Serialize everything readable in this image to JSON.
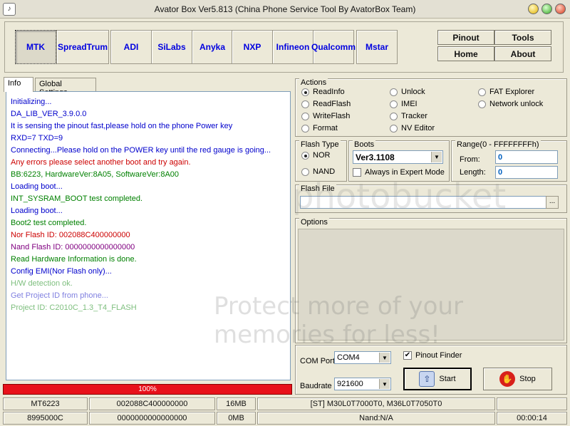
{
  "window": {
    "title": "Avator Box Ver5.813 (China Phone Service Tool By AvatorBox Team)"
  },
  "chips": [
    "MTK",
    "SpreadTrum",
    "ADI",
    "SiLabs",
    "Anyka",
    "NXP",
    "Infineon",
    "Qualcomm",
    "Mstar"
  ],
  "nav": {
    "pinout": "Pinout",
    "tools": "Tools",
    "home": "Home",
    "about": "About"
  },
  "tabs": {
    "info": "Info",
    "global": "Global Settings"
  },
  "log": [
    {
      "text": "Initializing...",
      "color": "#0000cc"
    },
    {
      "text": "DA_LIB_VER_3.9.0.0",
      "color": "#0000cc"
    },
    {
      "text": "It is sensing the pinout fast,please hold on the phone Power key",
      "color": "#0000cc"
    },
    {
      "text": "RXD=7  TXD=9",
      "color": "#0000cc"
    },
    {
      "text": "Connecting...Please hold on the POWER key until the red gauge is going...",
      "color": "#0000cc"
    },
    {
      "text": "Any errors please select another boot and try again.",
      "color": "#cc0000"
    },
    {
      "text": "BB:6223,     HardwareVer:8A05,     SoftwareVer:8A00",
      "color": "#008000"
    },
    {
      "text": "Loading boot...",
      "color": "#0000cc"
    },
    {
      "text": "INT_SYSRAM_BOOT test completed.",
      "color": "#008000"
    },
    {
      "text": "Loading boot...",
      "color": "#0000cc"
    },
    {
      "text": "Boot2 test completed.",
      "color": "#008000"
    },
    {
      "text": "Nor Flash ID: 002088C400000000",
      "color": "#cc0000"
    },
    {
      "text": "Nand Flash ID: 0000000000000000",
      "color": "#800080"
    },
    {
      "text": "Read Hardware Information is done.",
      "color": "#008000"
    },
    {
      "text": "Config EMI(Nor Flash only)...",
      "color": "#0000cc"
    },
    {
      "text": "H/W detection ok.",
      "color": "#7fbf7f"
    },
    {
      "text": "Get Project ID from phone...",
      "color": "#8080e0"
    },
    {
      "text": "Project ID: C2010C_1.3_T4_FLASH",
      "color": "#7fbf7f"
    }
  ],
  "progress": {
    "label": "100%",
    "value": 1.0
  },
  "actions": {
    "title": "Actions",
    "items": [
      "ReadInfo",
      "ReadFlash",
      "WriteFlash",
      "Format",
      "Unlock",
      "IMEI",
      "Tracker",
      "NV Editor",
      "FAT Explorer",
      "Network unlock"
    ],
    "selected": "ReadInfo"
  },
  "flash_type": {
    "title": "Flash Type",
    "nor": "NOR",
    "nand": "NAND",
    "selected": "NOR"
  },
  "boots": {
    "title": "Boots",
    "value": "Ver3.1108",
    "expert_label": "Always in Expert Mode",
    "expert_checked": false
  },
  "range": {
    "title": "Range(0 - FFFFFFFFh)",
    "from_label": "From:",
    "from_value": "0",
    "length_label": "Length:",
    "length_value": "0"
  },
  "flash_file": {
    "title": "Flash File",
    "browse": "..."
  },
  "options": {
    "title": "Options"
  },
  "com": {
    "port_label": "COM Port",
    "port_value": "COM4",
    "baud_label": "Baudrate",
    "baud_value": "921600",
    "finder_label": "Pinout Finder",
    "finder_checked": true
  },
  "buttons": {
    "start": "Start",
    "stop": "Stop"
  },
  "status": {
    "row1": [
      "MT6223",
      "002088C400000000",
      "16MB",
      "[ST] M30L0T7000T0, M36L0T7050T0",
      ""
    ],
    "row2": [
      "8995000C",
      "0000000000000000",
      "0MB",
      "Nand:N/A",
      "00:00:14"
    ]
  },
  "watermark": {
    "line1": "photobucket",
    "line2": "Protect more of your memories for less!"
  }
}
